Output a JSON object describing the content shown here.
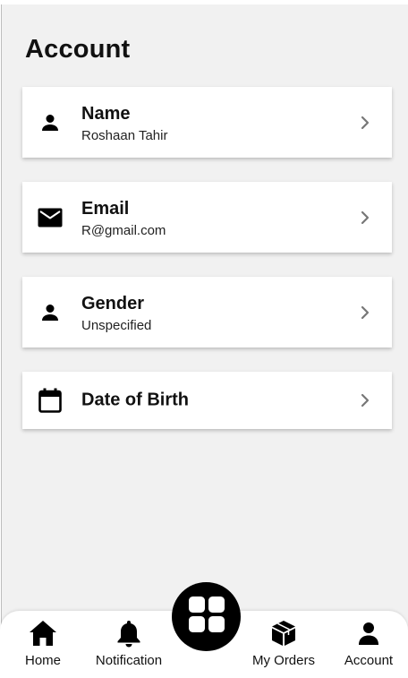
{
  "page": {
    "title": "Account"
  },
  "fields": [
    {
      "label": "Name",
      "value": "Roshaan Tahir",
      "icon": "person-icon"
    },
    {
      "label": "Email",
      "value": "R@gmail.com",
      "icon": "mail-icon"
    },
    {
      "label": "Gender",
      "value": "Unspecified",
      "icon": "person-icon"
    },
    {
      "label": "Date of Birth",
      "icon": "calendar-icon"
    }
  ],
  "nav": {
    "items": [
      {
        "label": "Home",
        "icon": "home-icon"
      },
      {
        "label": "Notification",
        "icon": "bell-icon"
      },
      {
        "label": "My Orders",
        "icon": "package-icon"
      },
      {
        "label": "Account",
        "icon": "person-icon"
      }
    ],
    "center_icon": "grid-icon"
  },
  "colors": {
    "background": "#f1f1f1",
    "card": "#ffffff",
    "text": "#111111",
    "chevron": "#777777",
    "fab": "#000000"
  }
}
